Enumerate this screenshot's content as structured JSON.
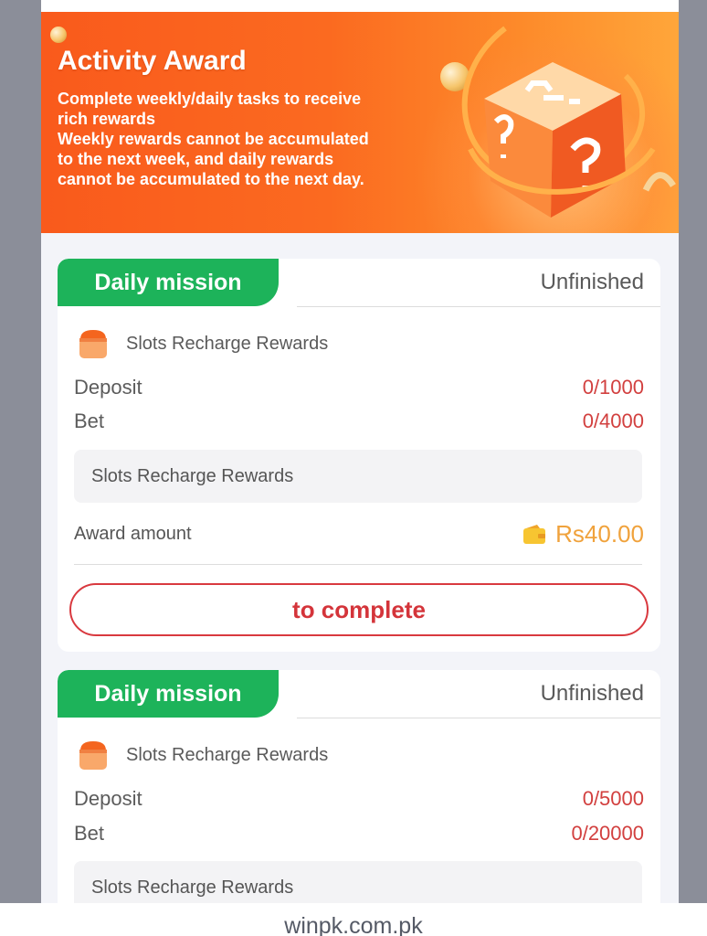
{
  "banner": {
    "title": "Activity Award",
    "description": "Complete weekly/daily tasks to receive\nrich rewards\nWeekly rewards cannot be accumulated\nto the next week, and daily rewards\ncannot be accumulated to the next day."
  },
  "missions": [
    {
      "tab_label": "Daily mission",
      "status": "Unfinished",
      "task_name": "Slots Recharge Rewards",
      "deposit_label": "Deposit",
      "deposit_value": "0/1000",
      "bet_label": "Bet",
      "bet_value": "0/4000",
      "description": "Slots Recharge Rewards",
      "award_label": "Award amount",
      "award_value": "Rs40.00",
      "button_label": "to complete"
    },
    {
      "tab_label": "Daily mission",
      "status": "Unfinished",
      "task_name": "Slots Recharge Rewards",
      "deposit_label": "Deposit",
      "deposit_value": "0/5000",
      "bet_label": "Bet",
      "bet_value": "0/20000",
      "description": "Slots Recharge Rewards"
    }
  ],
  "footer": {
    "url": "winpk.com.pk"
  },
  "colors": {
    "banner_orange": "#f95a1c",
    "mission_green": "#1db35a",
    "progress_red": "#d2403f",
    "award_gold": "#f0a23c",
    "button_red": "#d9393f"
  },
  "icons": {
    "task": "slots-chest-icon",
    "award": "wallet-icon",
    "banner": "mystery-cube-icon"
  }
}
